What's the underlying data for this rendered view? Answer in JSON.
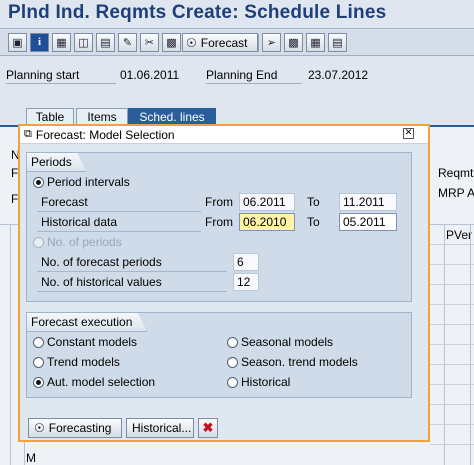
{
  "window": {
    "title": "Plnd Ind. Reqmts Create: Schedule Lines"
  },
  "toolbar": {
    "forecast_label": "Forecast"
  },
  "header": {
    "planning_start_label": "Planning start",
    "planning_start_value": "01.06.2011",
    "planning_end_label": "Planning End",
    "planning_end_value": "23.07.2012"
  },
  "tabs": [
    {
      "label": "Table"
    },
    {
      "label": "Items"
    },
    {
      "label": "Sched. lines"
    }
  ],
  "background": {
    "left_glyphs": [
      "N",
      "F",
      "F",
      "M"
    ],
    "right_label_1": "Reqmts",
    "right_label_2": "MRP A",
    "col_header": "PVer"
  },
  "dialog": {
    "title": "Forecast: Model Selection",
    "periods": {
      "group_title": "Periods",
      "period_intervals_label": "Period intervals",
      "forecast_label": "Forecast",
      "historical_label": "Historical data",
      "from_label": "From",
      "to_label": "To",
      "forecast_from": "06.2011",
      "forecast_to": "11.2011",
      "historical_from": "06.2010",
      "historical_to": "05.2011",
      "no_of_periods_label": "No. of periods",
      "forecast_periods_label": "No. of forecast periods",
      "forecast_periods_value": "6",
      "historical_values_label": "No. of historical values",
      "historical_values_value": "12"
    },
    "execution": {
      "group_title": "Forecast execution",
      "constant": "Constant models",
      "trend": "Trend models",
      "auto": "Aut. model selection",
      "seasonal": "Seasonal models",
      "season_trend": "Season. trend models",
      "historical": "Historical"
    },
    "buttons": {
      "forecasting": "Forecasting",
      "historical": "Historical..."
    }
  }
}
